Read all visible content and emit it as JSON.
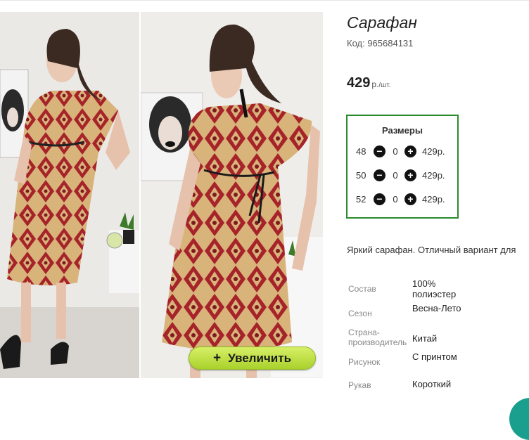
{
  "product": {
    "title": "Сарафан",
    "code": "Код: 965684131",
    "price_value": "429",
    "price_unit": "р.",
    "price_per": "/шт."
  },
  "zoom_button": {
    "icon": "+",
    "label": "Увеличить"
  },
  "sizes": {
    "title": "Размеры",
    "rows": [
      {
        "size": "48",
        "qty": "0",
        "price": "429р."
      },
      {
        "size": "50",
        "qty": "0",
        "price": "429р."
      },
      {
        "size": "52",
        "qty": "0",
        "price": "429р."
      }
    ]
  },
  "description": "Яркий сарафан. Отличный вариант для",
  "properties": [
    {
      "key": "Состав",
      "value": "100% полиэстер"
    },
    {
      "key": "Сезон",
      "value": "Весна-Лето"
    },
    {
      "key": "Страна-производитель",
      "value": "Китай"
    },
    {
      "key": "Рисунок",
      "value": "С принтом"
    },
    {
      "key": "Рукав",
      "value": "Короткий"
    }
  ],
  "colors": {
    "accent_green": "#2b8a2b",
    "button_lime": "#b5dc3a",
    "dress_red": "#a6232a",
    "dress_beige": "#d8b37a",
    "chat_teal": "#1a9e8e"
  }
}
